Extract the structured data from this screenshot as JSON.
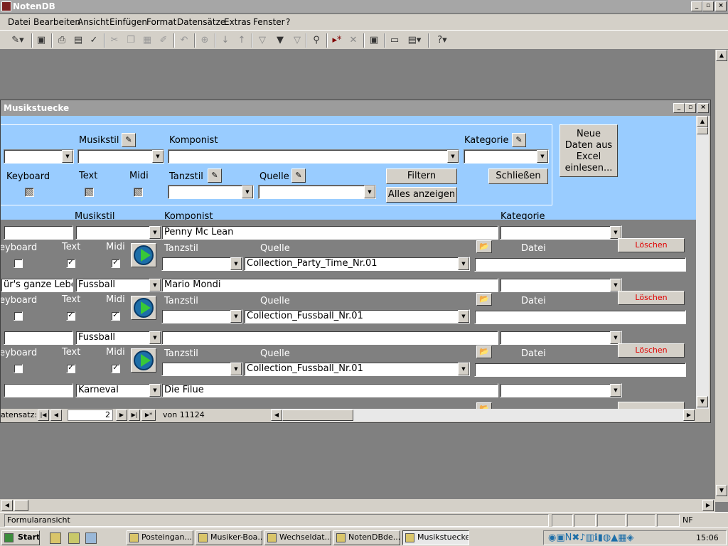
{
  "app": {
    "title": "NotenDB"
  },
  "menu": [
    "Datei",
    "Bearbeiten",
    "Ansicht",
    "Einfügen",
    "Format",
    "Datensätze",
    "Extras",
    "Fenster",
    "?"
  ],
  "toolbar_icons": [
    "design-view-icon",
    "save-icon",
    "print-icon",
    "print-preview-icon",
    "spellcheck-icon",
    "cut-icon",
    "copy-icon",
    "paste-icon",
    "format-painter-icon",
    "undo-icon",
    "hyperlink-icon",
    "sort-asc-icon",
    "sort-desc-icon",
    "filter-selection-icon",
    "filter-form-icon",
    "apply-filter-icon",
    "find-icon",
    "new-record-icon",
    "delete-record-icon",
    "properties-icon",
    "database-window-icon",
    "new-object-icon",
    "help-icon"
  ],
  "form": {
    "title": "Musikstuecke",
    "filter": {
      "musikstil_label": "Musikstil",
      "komponist_label": "Komponist",
      "kategorie_label": "Kategorie",
      "keyboard_label": "Keyboard",
      "text_label": "Text",
      "midi_label": "Midi",
      "tanzstil_label": "Tanzstil",
      "quelle_label": "Quelle",
      "filtern": "Filtern",
      "alles_anzeigen": "Alles anzeigen",
      "schliessen": "Schließen",
      "neue_daten": "Neue Daten aus Excel einlesen..."
    },
    "columns": {
      "musikstil": "Musikstil",
      "komponist": "Komponist",
      "kategorie": "Kategorie"
    },
    "record_labels": {
      "keyboard": "eyboard",
      "text": "Text",
      "midi": "Midi",
      "tanzstil": "Tanzstil",
      "quelle": "Quelle",
      "datei": "Datei",
      "loeschen": "Löschen"
    },
    "records": [
      {
        "titel": "",
        "musikstil": "",
        "komponist": "Penny Mc Lean",
        "kategorie": "",
        "quelle": "Collection_Party_Time_Nr.01",
        "keyboard": false,
        "text": true,
        "midi": true
      },
      {
        "titel": "ür's ganze Leben",
        "musikstil": "Fussball",
        "komponist": "Mario Mondi",
        "kategorie": "",
        "quelle": "Collection_Fussball_Nr.01",
        "keyboard": false,
        "text": true,
        "midi": true
      },
      {
        "titel": "",
        "musikstil": "Fussball",
        "komponist": "",
        "kategorie": "",
        "quelle": "Collection_Fussball_Nr.01",
        "keyboard": false,
        "text": true,
        "midi": true
      },
      {
        "titel": "",
        "musikstil": "Karneval",
        "komponist": "Die Filue",
        "kategorie": "",
        "quelle": "",
        "keyboard": false,
        "text": false,
        "midi": false
      }
    ],
    "nav": {
      "label": "atensatz:",
      "current": "2",
      "of": "von  11124"
    }
  },
  "status": {
    "text": "Formularansicht",
    "nf": "NF"
  },
  "taskbar": {
    "start": "Start",
    "tasks": [
      "Posteingan...",
      "Musiker-Boa...",
      "Wechseldat...",
      "NotenDBde...",
      "Musikstuecke"
    ],
    "clock": "15:06"
  }
}
